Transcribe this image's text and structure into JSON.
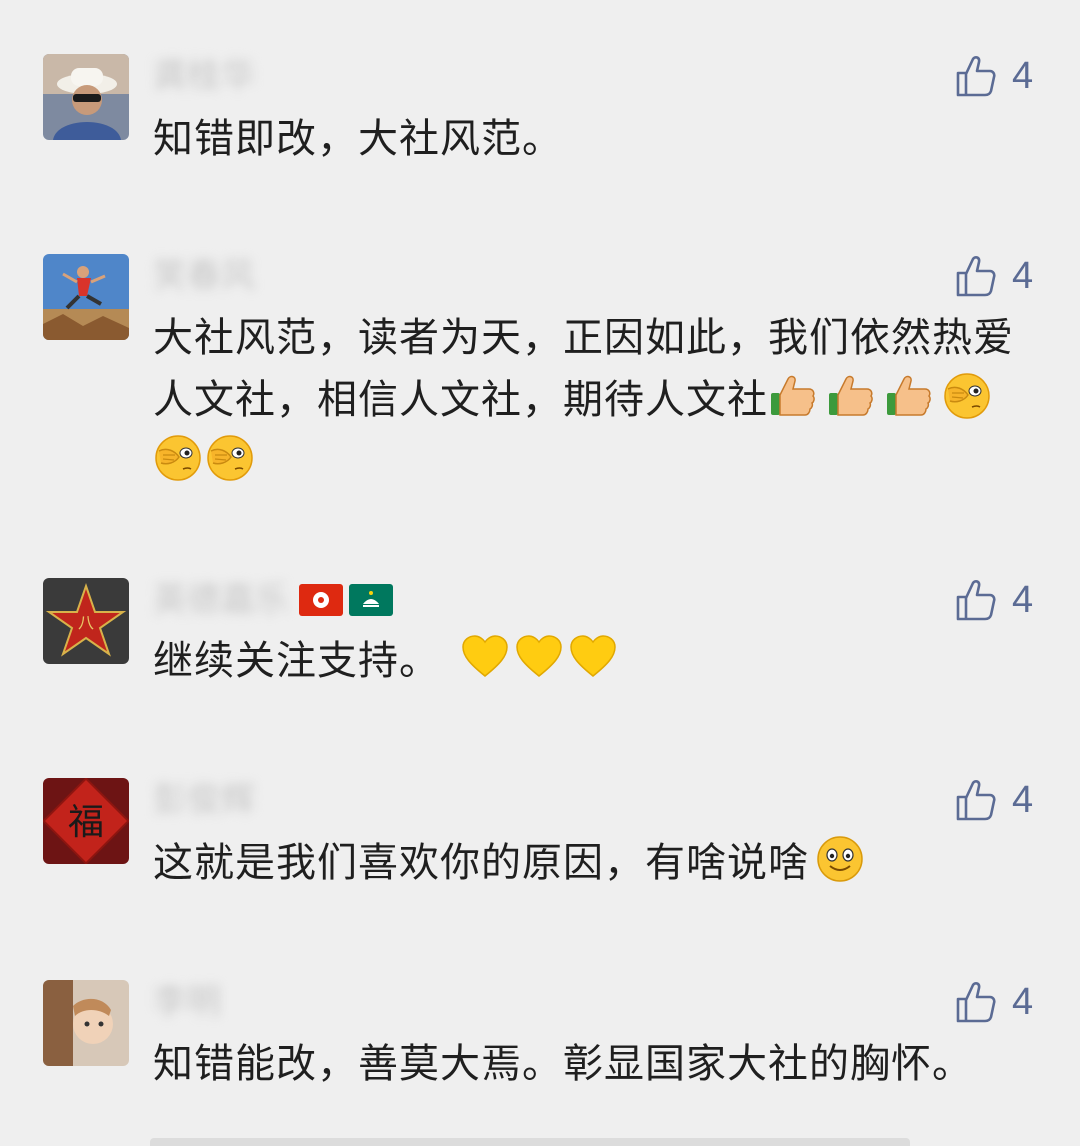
{
  "comments": [
    {
      "name": "龚桂华",
      "text": "知错即改，大社风范。",
      "likes": "4",
      "avatar": "avatar-man-white-hat"
    },
    {
      "name": "笑春风",
      "text": "大社风范，读者为天，正因如此，我们依然热爱人文社，相信人文社，期待人文社",
      "likes": "4",
      "avatar": "avatar-jumping-man",
      "emojis": [
        "thumbs-up-icon",
        "thumbs-up-icon",
        "thumbs-up-icon",
        "facepalm-icon",
        "facepalm-icon",
        "facepalm-icon"
      ]
    },
    {
      "name": "英德嘉乐",
      "text": "继续关注支持。",
      "likes": "4",
      "avatar": "avatar-red-star",
      "name_flags": [
        "hong-kong-flag-icon",
        "macau-flag-icon"
      ],
      "emojis": [
        "yellow-heart-icon",
        "yellow-heart-icon",
        "yellow-heart-icon"
      ]
    },
    {
      "name": "彭俊辉",
      "text": "这就是我们喜欢你的原因，有啥说啥",
      "likes": "4",
      "avatar": "avatar-fu-character",
      "emojis": [
        "smile-icon"
      ]
    },
    {
      "name": "李明",
      "text": "知错能改，善莫大焉。彰显国家大社的胸怀。",
      "likes": "4",
      "avatar": "avatar-child-door"
    }
  ],
  "colors": {
    "background": "#efefef",
    "name_color": "#c7c7c7",
    "like_color": "#5b6b94",
    "text_color": "#1f1f1f"
  }
}
